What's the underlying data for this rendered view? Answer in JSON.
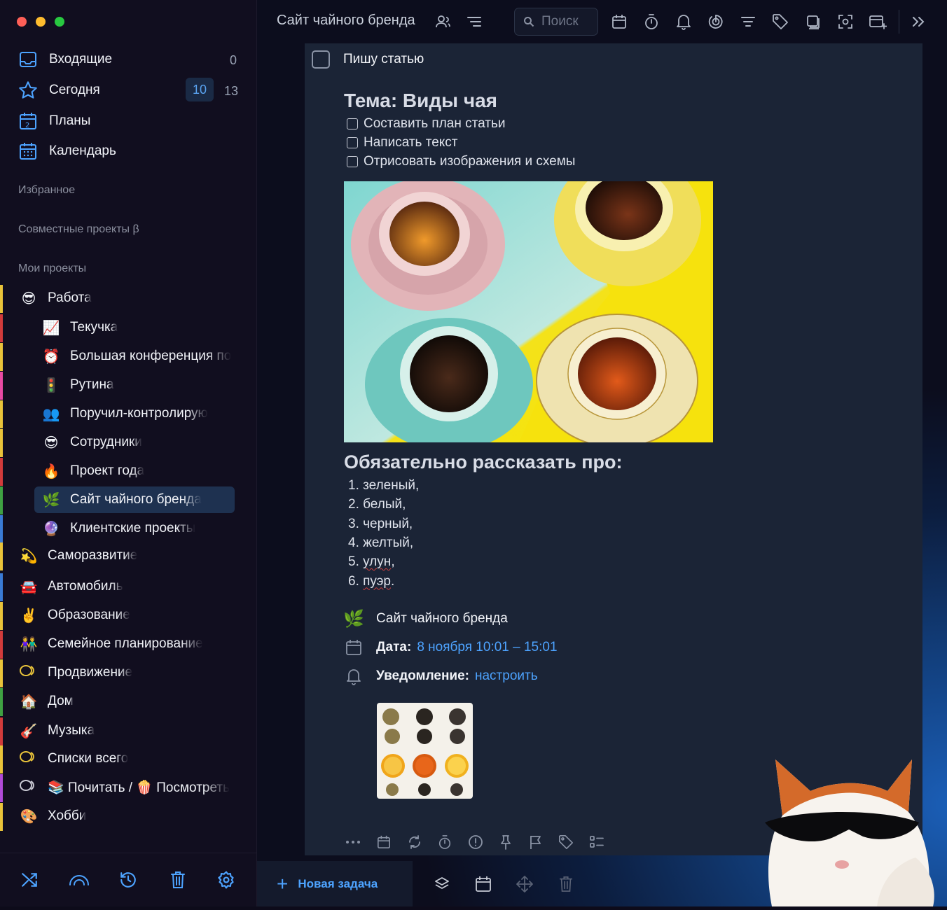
{
  "window": {
    "controls": [
      "close",
      "minimize",
      "zoom"
    ]
  },
  "sidebar": {
    "nav": [
      {
        "label": "Входящие",
        "count": "0",
        "icon": "inbox-icon"
      },
      {
        "label": "Сегодня",
        "badge": "10",
        "count": "13",
        "icon": "star-icon"
      },
      {
        "label": "Планы",
        "icon": "plans-calendar-icon"
      },
      {
        "label": "Календарь",
        "icon": "calendar-icon"
      }
    ],
    "sections": {
      "favorites": "Избранное",
      "shared": "Совместные проекты β",
      "mine": "Мои проекты"
    },
    "projects": [
      {
        "label": "Работа",
        "emoji": "😎",
        "color": "#e9c33a"
      },
      {
        "label": "Текучка",
        "emoji": "📈",
        "child": true,
        "color": "#d23b3b"
      },
      {
        "label": "Большая конференция по",
        "emoji": "⏰",
        "child": true,
        "color": "#e9c33a"
      },
      {
        "label": "Рутина",
        "emoji": "🚦",
        "child": true,
        "color": "#e94aa3"
      },
      {
        "label": "Поручил-контролирую",
        "emoji": "👥",
        "child": true,
        "color": "#e9c33a"
      },
      {
        "label": "Сотрудники",
        "emoji": "😎",
        "child": true,
        "color": "#e9c33a"
      },
      {
        "label": "Проект года",
        "emoji": "🔥",
        "child": true,
        "color": "#d23b3b"
      },
      {
        "label": "Сайт чайного бренда",
        "emoji": "🌿",
        "child": true,
        "active": true,
        "color": "#3fa142"
      },
      {
        "label": "Клиентские проекты",
        "emoji": "🔮",
        "child": true,
        "color": "#3a7bd5"
      },
      {
        "label": "Саморазвитие",
        "emoji": "💫",
        "color": "#e9c33a"
      },
      {
        "label": "Автомобиль",
        "emoji": "🚘",
        "color": "#3a7bd5"
      },
      {
        "label": "Образование",
        "emoji": "✌️",
        "color": "#e9c33a"
      },
      {
        "label": "Семейное планирование",
        "emoji": "👫",
        "color": "#d23b3b"
      },
      {
        "label": "Продвижение",
        "emoji": "",
        "ring": "#e9c33a",
        "color": "#e9c33a"
      },
      {
        "label": "Дом",
        "emoji": "🏠",
        "color": "#3fa142"
      },
      {
        "label": "Музыка",
        "emoji": "🎸",
        "color": "#d23b3b"
      },
      {
        "label": "Списки всего",
        "emoji": "",
        "ring": "#e9c33a",
        "color": "#e9c33a"
      },
      {
        "label": "📚 Почитать / 🍿 Посмотреть",
        "emoji": "",
        "ring": "#c9c9d3",
        "color": "#b04ad8"
      },
      {
        "label": "Хобби",
        "emoji": "🎨",
        "color": "#e9c33a"
      }
    ],
    "footer_icons": [
      "shuffle-icon",
      "signal-icon",
      "history-icon",
      "trash-icon",
      "settings-icon"
    ]
  },
  "toolbar": {
    "title": "Сайт чайного бренда",
    "search_placeholder": "Поиск"
  },
  "task": {
    "title": "Пишу статью",
    "heading": "Тема: Виды чая",
    "subtasks": [
      "Составить план статьи",
      "Написать текст",
      "Отрисовать изображения и схемы"
    ],
    "heading2": "Обязательно рассказать про:",
    "list": [
      {
        "n": "1.",
        "text": "зеленый,",
        "spell": false
      },
      {
        "n": "2.",
        "text": "белый,",
        "spell": false
      },
      {
        "n": "3.",
        "text": "черный,",
        "spell": false
      },
      {
        "n": "4.",
        "text": "желтый,",
        "spell": false
      },
      {
        "n": "5.",
        "text": "улун",
        "suffix": ",",
        "spell": true
      },
      {
        "n": "6.",
        "text": "пуэр",
        "suffix": ".",
        "spell": true
      }
    ],
    "project": "Сайт чайного бренда",
    "date_label": "Дата:",
    "date_value": "8 ноября 10:01 – 15:01",
    "notify_label": "Уведомление:",
    "notify_value": "настроить"
  },
  "bottom": {
    "new_task": "Новая задача"
  },
  "colors": {
    "accent": "#4da3ff",
    "card": "#1b2436",
    "sidebar": "#110e1f"
  }
}
